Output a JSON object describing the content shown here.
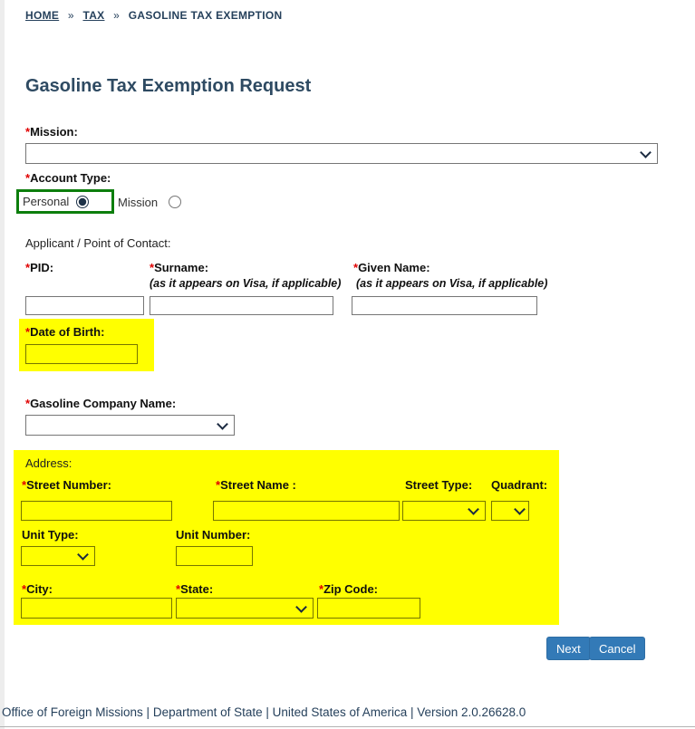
{
  "breadcrumb": {
    "home": "HOME",
    "sep": "»",
    "tax": "TAX",
    "current": "GASOLINE TAX EXEMPTION"
  },
  "page": {
    "title": "Gasoline Tax Exemption Request"
  },
  "form": {
    "required_marker": "*",
    "mission": {
      "label": "Mission:",
      "value": ""
    },
    "account_type": {
      "label": "Account Type:",
      "options": [
        {
          "label": "Personal",
          "selected": true
        },
        {
          "label": "Mission",
          "selected": false
        }
      ]
    },
    "applicant": {
      "heading": "Applicant / Point of Contact:",
      "pid": {
        "label": "PID:",
        "value": ""
      },
      "surname": {
        "label": "Surname:",
        "note": "(as it appears on Visa, if applicable)",
        "value": ""
      },
      "given_name": {
        "label": "Given Name:",
        "note": "(as it appears on Visa, if applicable)",
        "value": ""
      },
      "date_of_birth": {
        "label": "Date of Birth:",
        "value": ""
      }
    },
    "gas_company": {
      "label": "Gasoline Company Name:",
      "value": ""
    },
    "address": {
      "heading": "Address:",
      "street_number": {
        "label": "Street Number:",
        "required": true,
        "value": ""
      },
      "street_name": {
        "label": "Street Name :",
        "required": true,
        "value": ""
      },
      "street_type": {
        "label": "Street Type:",
        "required": false,
        "value": ""
      },
      "quadrant": {
        "label": "Quadrant:",
        "required": false,
        "value": ""
      },
      "unit_type": {
        "label": "Unit Type:",
        "required": false,
        "value": ""
      },
      "unit_number": {
        "label": "Unit Number:",
        "required": false,
        "value": ""
      },
      "city": {
        "label": "City:",
        "required": true,
        "value": ""
      },
      "state": {
        "label": "State:",
        "required": true,
        "value": ""
      },
      "zip": {
        "label": "Zip Code:",
        "required": true,
        "value": ""
      }
    }
  },
  "buttons": {
    "next": "Next",
    "cancel": "Cancel"
  },
  "footer": {
    "text": "Office of Foreign Missions | Department of State | United States of America | Version 2.0.26628.0"
  },
  "colors": {
    "required_asterisk": "#e00000",
    "highlight_yellow": "#ffff00",
    "focus_box_green": "#0c7e0c",
    "button_blue": "#337ab7",
    "heading_navy": "#2e4a62",
    "link_navy": "#26415c"
  }
}
